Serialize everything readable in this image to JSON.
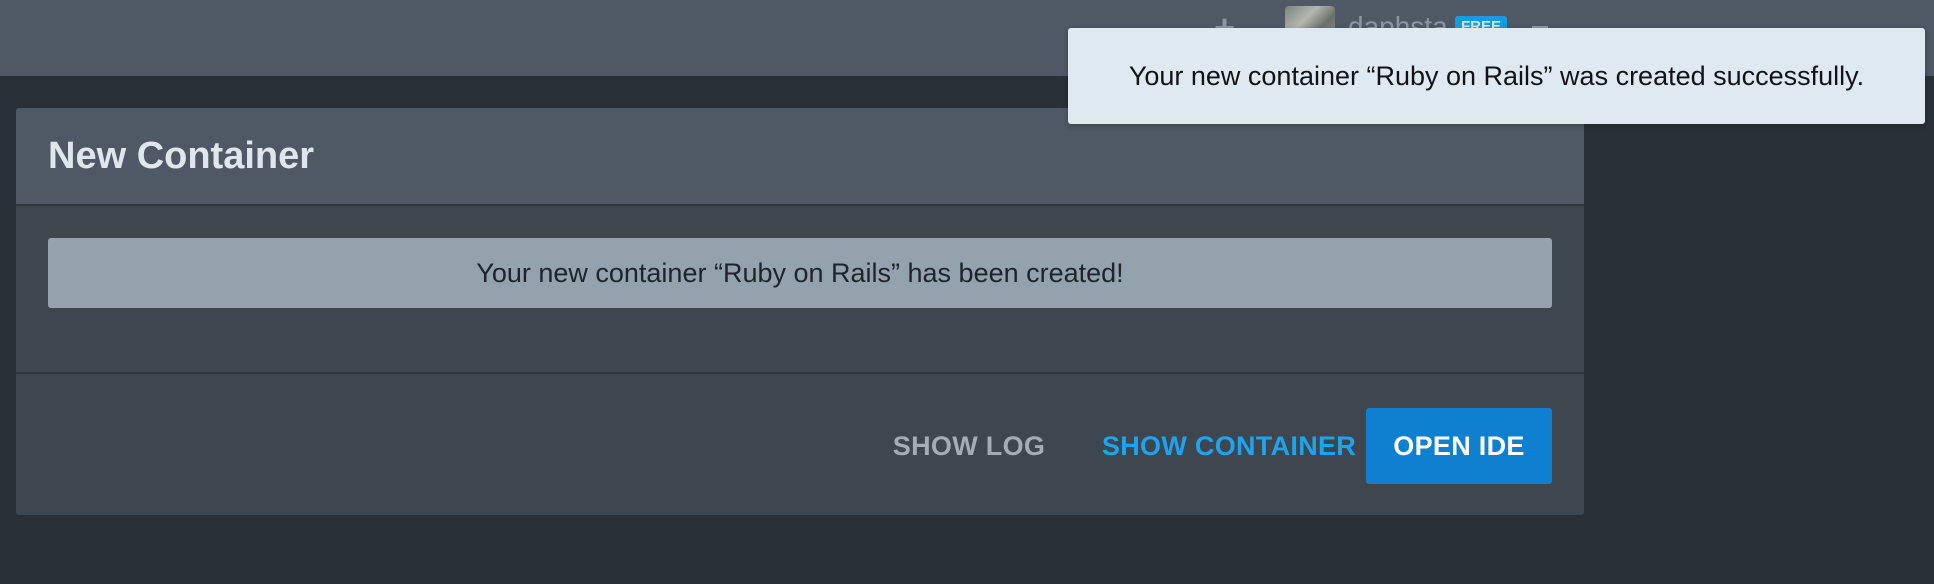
{
  "header": {
    "add_icon": "plus-icon",
    "add_glyph": "+",
    "username": "daphsta",
    "plan_badge": "FREE",
    "menu_icon": "chevron-down-icon"
  },
  "panel": {
    "title": "New Container",
    "message": "Your new container “Ruby on Rails” has been created!",
    "buttons": {
      "show_log": "SHOW LOG",
      "show_container": "SHOW CONTAINER",
      "open_ide": "OPEN IDE"
    }
  },
  "toast": {
    "message": "Your new container “Ruby on Rails” was created successfully."
  },
  "colors": {
    "topbar": "#4e5965",
    "background": "#2a3038",
    "panel": "#3e4650",
    "primary": "#0e80cf",
    "link": "#1ea3ee",
    "badge": "#1a9be0",
    "toast_bg": "#dfe9f1"
  }
}
